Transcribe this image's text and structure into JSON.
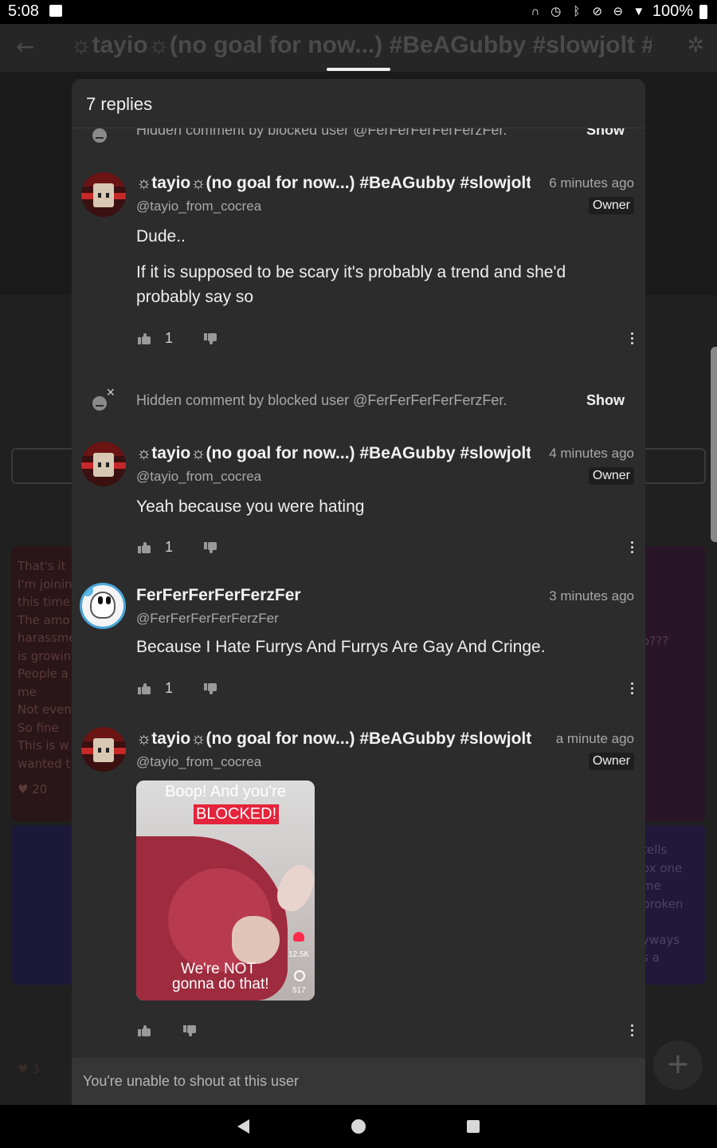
{
  "status_bar": {
    "time": "5:08",
    "battery": "100%"
  },
  "background": {
    "title": "☼tayio☼(no goal for now...) #BeAGubby #slowjolt #Do",
    "left_card_lines": [
      "That's it",
      "I'm joinin",
      "this time",
      "The amo",
      "harassme",
      "is growin",
      "People a",
      "me",
      "Not even",
      "So fine",
      "This is w",
      "wanted t"
    ],
    "left_card_likes": "20",
    "right_card_text": "o???",
    "right_card2_lines": [
      "tells",
      "ox one",
      "me",
      "broken",
      "",
      "yways",
      "s a"
    ],
    "bottom_likes": "3"
  },
  "sheet": {
    "title": "7 replies",
    "hidden_comment_text": "Hidden comment by blocked user @FerFerFerFerFerzFer.",
    "show_label": "Show",
    "footer_text": "You're unable to shout at this user"
  },
  "comments": [
    {
      "name": "☼tayio☼(no goal for now...) #BeAGubby #slowjolt",
      "time": "6 minutes ago",
      "handle": "@tayio_from_cocrea",
      "badge": "Owner",
      "paragraphs": [
        "Dude..",
        "If it is supposed to be scary it's probably a trend and she'd probably say so"
      ],
      "likes": "1"
    },
    {
      "name": "☼tayio☼(no goal for now...) #BeAGubby #slowjolt",
      "time": "4 minutes ago",
      "handle": "@tayio_from_cocrea",
      "badge": "Owner",
      "paragraphs": [
        "Yeah because you were hating"
      ],
      "likes": "1"
    },
    {
      "name": "FerFerFerFerFerzFer",
      "time": "3 minutes ago",
      "handle": "@FerFerFerFerFerzFer",
      "paragraphs": [
        "Because I Hate Furrys And Furrys Are Gay And Cringe."
      ],
      "likes": "1"
    },
    {
      "name": "☼tayio☼(no goal for now...) #BeAGubby #slowjolt",
      "time": "a minute ago",
      "handle": "@tayio_from_cocrea",
      "badge": "Owner",
      "sticker": {
        "line1": "Boop! And you're",
        "line2": "BLOCKED!",
        "caption1": "We're NOT",
        "caption2": "gonna do that!",
        "likes": "12.5K",
        "comments": "517"
      }
    }
  ],
  "icons": {
    "like": "thumb-up-icon",
    "dislike": "thumb-down-icon",
    "more": "more-vert-icon",
    "blocked": "blocked-user-icon"
  },
  "colors": {
    "sheet_bg": "#2c2c2c",
    "accent_red": "#e4243b"
  }
}
